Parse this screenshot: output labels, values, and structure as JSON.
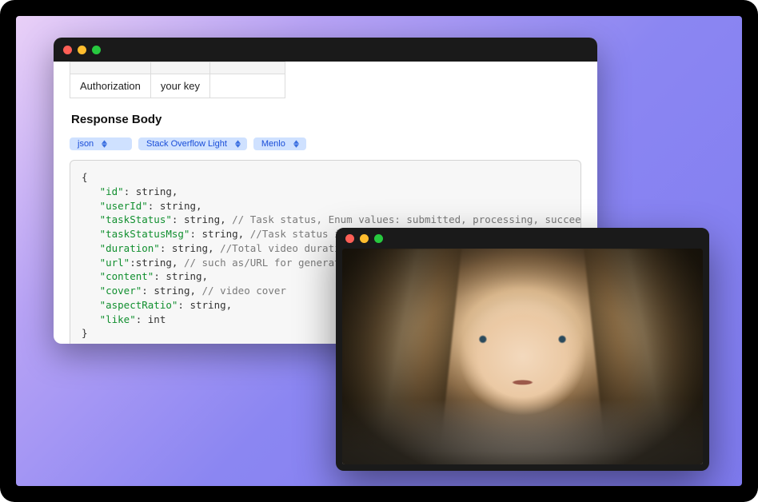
{
  "auth": {
    "key_label": "Authorization",
    "value_label": "your key"
  },
  "section": {
    "response_body": "Response Body"
  },
  "selectors": {
    "format": "json",
    "theme": "Stack Overflow Light",
    "font": "Menlo"
  },
  "code": {
    "open": "{",
    "close": "}",
    "lines": [
      {
        "key": "\"id\"",
        "rest": ": string,"
      },
      {
        "key": "\"userId\"",
        "rest": ": string,"
      },
      {
        "key": "\"taskStatus\"",
        "rest": ": string, ",
        "comment": "// Task status, Enum values: submitted, processing, succeed, fai"
      },
      {
        "key": "\"taskStatusMsg\"",
        "rest": ": string, ",
        "comment": "//Task status in"
      },
      {
        "key": "\"duration\"",
        "rest": ": string, ",
        "comment": "//Total video duratio"
      },
      {
        "key": "\"url\"",
        "rest": ":string, ",
        "comment": "// such as/URL for generati"
      },
      {
        "key": "\"content\"",
        "rest": ": string,"
      },
      {
        "key": "\"cover\"",
        "rest": ": string, ",
        "comment": "// video cover"
      },
      {
        "key": "\"aspectRatio\"",
        "rest": ": string,"
      },
      {
        "key": "\"like\"",
        "rest": ": int"
      }
    ]
  }
}
